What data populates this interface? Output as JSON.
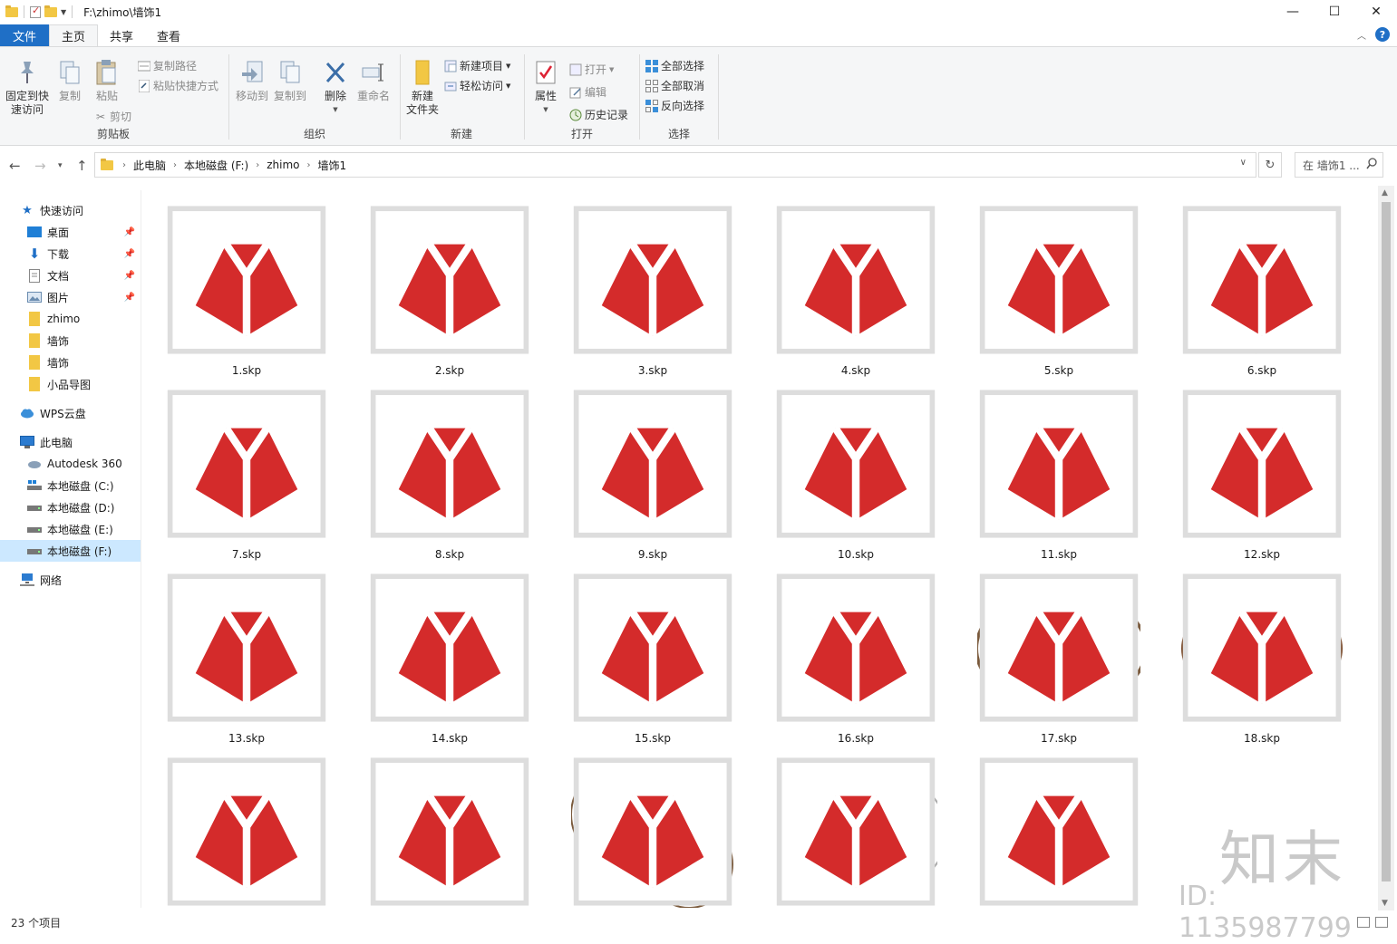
{
  "window": {
    "title": "F:\\zhimo\\墙饰1",
    "minimize": "—",
    "maximize": "☐",
    "close": "✕"
  },
  "ribbon_tabs": [
    "文件",
    "主页",
    "共享",
    "查看"
  ],
  "ribbon": {
    "clipboard": {
      "pin_label": "固定到快\n速访问",
      "copy": "复制",
      "paste": "粘贴",
      "copy_path": "复制路径",
      "paste_shortcut": "粘贴快捷方式",
      "cut": "剪切",
      "group": "剪贴板"
    },
    "organize": {
      "move_to": "移动到",
      "copy_to": "复制到",
      "delete": "删除",
      "rename": "重命名",
      "group": "组织"
    },
    "new": {
      "new_folder": "新建\n文件夹",
      "new_item": "新建项目",
      "easy_access": "轻松访问",
      "group": "新建"
    },
    "open": {
      "properties": "属性",
      "open": "打开",
      "edit": "编辑",
      "history": "历史记录",
      "group": "打开"
    },
    "select": {
      "select_all": "全部选择",
      "select_none": "全部取消",
      "invert": "反向选择",
      "group": "选择"
    }
  },
  "breadcrumb": [
    "此电脑",
    "本地磁盘 (F:)",
    "zhimo",
    "墙饰1"
  ],
  "search_placeholder": "在 墙饰1 ...",
  "sidebar": {
    "quick_access": "快速访问",
    "items": [
      {
        "label": "桌面",
        "pinned": true
      },
      {
        "label": "下载",
        "pinned": true
      },
      {
        "label": "文档",
        "pinned": true
      },
      {
        "label": "图片",
        "pinned": true
      },
      {
        "label": "zhimo",
        "pinned": false
      },
      {
        "label": "墙饰",
        "pinned": false
      },
      {
        "label": "墙饰",
        "pinned": false
      },
      {
        "label": "小品导图",
        "pinned": false
      }
    ],
    "wps": "WPS云盘",
    "this_pc": "此电脑",
    "drives": [
      "Autodesk 360",
      "本地磁盘 (C:)",
      "本地磁盘 (D:)",
      "本地磁盘 (E:)",
      "本地磁盘 (F:)"
    ],
    "network": "网络"
  },
  "files": [
    "1.skp",
    "2.skp",
    "3.skp",
    "4.skp",
    "5.skp",
    "6.skp",
    "7.skp",
    "8.skp",
    "9.skp",
    "10.skp",
    "11.skp",
    "12.skp",
    "13.skp",
    "14.skp",
    "15.skp",
    "16.skp",
    "17.skp",
    "18.skp",
    "",
    "",
    "",
    "",
    ""
  ],
  "status": "23 个项目",
  "watermark": {
    "brand": "知末",
    "id": "ID: 1135987799"
  },
  "colors": {
    "accent": "#1f6fc6",
    "selection": "#cce8ff",
    "wood": "#7a5a3c",
    "skp_red": "#d42b2b"
  }
}
